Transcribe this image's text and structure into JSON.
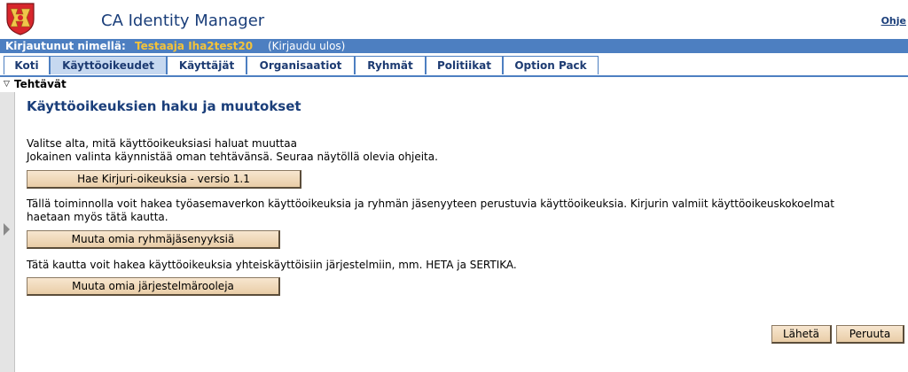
{
  "header": {
    "app_title": "CA Identity Manager",
    "help_link": "Ohje"
  },
  "login_bar": {
    "label": "Kirjautunut nimellä:",
    "user": "Testaaja Iha2test20",
    "logout": "(Kirjaudu ulos)"
  },
  "tabs": [
    {
      "label": "Koti",
      "active": false
    },
    {
      "label": "Käyttöoikeudet",
      "active": true
    },
    {
      "label": "Käyttäjät",
      "active": false
    },
    {
      "label": "Organisaatiot",
      "active": false
    },
    {
      "label": "Ryhmät",
      "active": false
    },
    {
      "label": "Politiikat",
      "active": false
    },
    {
      "label": "Option Pack",
      "active": false
    }
  ],
  "tasks_label": "Tehtävät",
  "main": {
    "title": "Käyttöoikeuksien haku ja muutokset",
    "intro_line1": "Valitse alta, mitä käyttöoikeuksiasi haluat muuttaa",
    "intro_line2": "Jokainen valinta käynnistää oman tehtävänsä. Seuraa näytöllä olevia ohjeita.",
    "btn1_label": "Hae Kirjuri-oikeuksia - versio 1.1",
    "desc1_line1": "Tällä toiminnolla voit hakea työasemaverkon käyttöoikeuksia ja ryhmän jäsenyyteen perustuvia käyttöoikeuksia. Kirjurin valmiit käyttöoikeuskokoelmat",
    "desc1_line2": "haetaan myös tätä kautta.",
    "btn2_label": "Muuta omia ryhmäjäsenyyksiä",
    "desc2": "Tätä kautta voit hakea käyttöoikeuksia yhteiskäyttöisiin järjestelmiin, mm. HETA ja SERTIKA.",
    "btn3_label": "Muuta omia järjestelmärooleja"
  },
  "footer": {
    "submit_label": "Lähetä",
    "cancel_label": "Peruuta"
  },
  "colors": {
    "brand_blue": "#4d7fc1",
    "title_blue": "#1a3e7a",
    "user_yellow": "#f3c33a",
    "active_tab": "#c6d8f0"
  }
}
